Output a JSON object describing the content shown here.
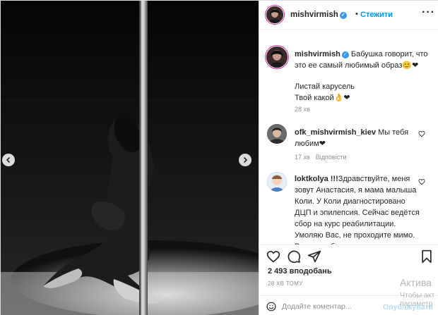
{
  "post": {
    "username": "mishvirmish",
    "follow_label": "Стежити",
    "more_icon": "more-horizontal-icon",
    "verified_icon": "verified-badge-icon"
  },
  "caption": {
    "username": "mishvirmish",
    "line1": "Бабушка говорит, что это ее самый любимый образ😊❤",
    "line2": "Листай карусель",
    "line3": "Твой какой👌❤",
    "time": "28 хв"
  },
  "comments": [
    {
      "username": "ofk_mishvirmish_kiev",
      "text": "Мы тебя любим❤",
      "time": "17 хв",
      "reply_label": "Відповісти"
    },
    {
      "username": "loktkolya !!!",
      "text": "Здравствуйте, меня зовут Анастасия, я мама малыша Коли. У Коли диагностировано ДЦП и эпилепсия. Сейчас ведётся сбор на курс реабилитации. Умоляю Вас, не проходите мимо. Важна любая"
    }
  ],
  "actions": {
    "likes": "2 493 вподобань",
    "posted_time": "28 ХВ ТОМУ"
  },
  "add_comment": {
    "placeholder": "Додайте коментар...",
    "post_label": "Опублікувати"
  },
  "windows_overlay": {
    "title": "Актива",
    "subtitle": "Чтобы акт параметр"
  },
  "colors": {
    "link_blue": "#0095f6",
    "heart_red": "#ed4956",
    "muted": "#8e8e8e"
  }
}
